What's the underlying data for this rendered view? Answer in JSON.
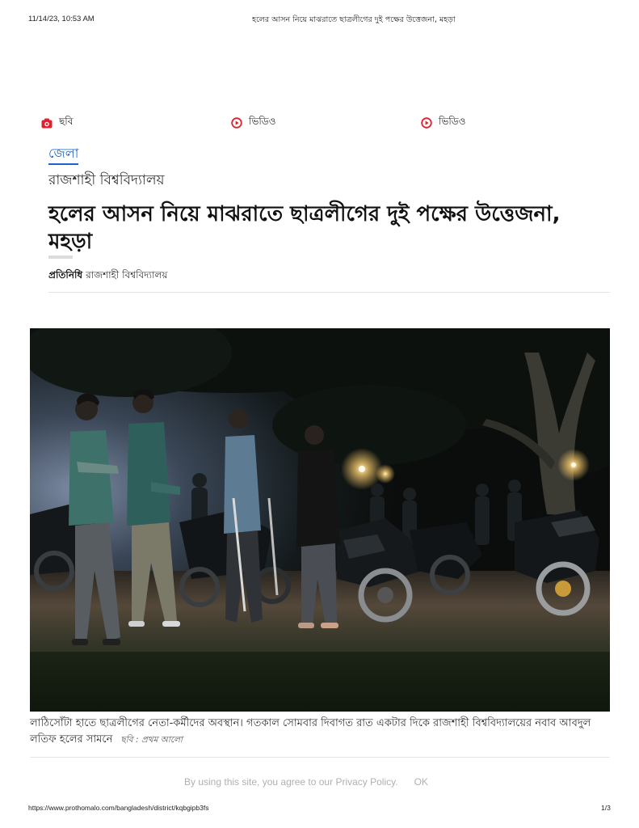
{
  "print_header": {
    "datetime": "11/14/23, 10:53 AM",
    "title": "হলের আসন নিয়ে মাঝরাতে ছাত্রলীগের দুই পক্ষের উত্তেজনা, মহড়া"
  },
  "nav": {
    "items": [
      {
        "label": "ছবি",
        "icon": "camera-icon"
      },
      {
        "label": "ভিডিও",
        "icon": "play-icon"
      },
      {
        "label": "ভিডিও",
        "icon": "play-icon"
      }
    ]
  },
  "article": {
    "section": "জেলা",
    "subsection": "রাজশাহী বিশ্ববিদ্যালয়",
    "headline": "হলের আসন নিয়ে মাঝরাতে ছাত্রলীগের দুই পক্ষের উত্তেজনা, মহড়া",
    "byline": {
      "author": "প্রতিনিধি",
      "location": "রাজশাহী বিশ্ববিদ্যালয়"
    },
    "photo": {
      "caption": "লাঠিসোঁটা হাতে ছাত্রলীগের নেতা-কর্মীদের অবস্থান। গতকাল সোমবার দিবাগত রাত একটার দিকে রাজশাহী বিশ্ববিদ্যালয়ের নবাব আবদুল লতিফ হলের সামনে",
      "credit": "ছবি : প্রথম আলো"
    }
  },
  "cookie_banner": {
    "text_prefix": "By using this site, you agree to our ",
    "link": "Privacy Policy",
    "text_suffix": ".",
    "ok_label": "OK"
  },
  "print_footer": {
    "url": "https://www.prothomalo.com/bangladesh/district/kqbgipb3fs",
    "page": "1/3"
  },
  "colors": {
    "accent_red": "#e0202c",
    "link_blue": "#1a64c8"
  }
}
